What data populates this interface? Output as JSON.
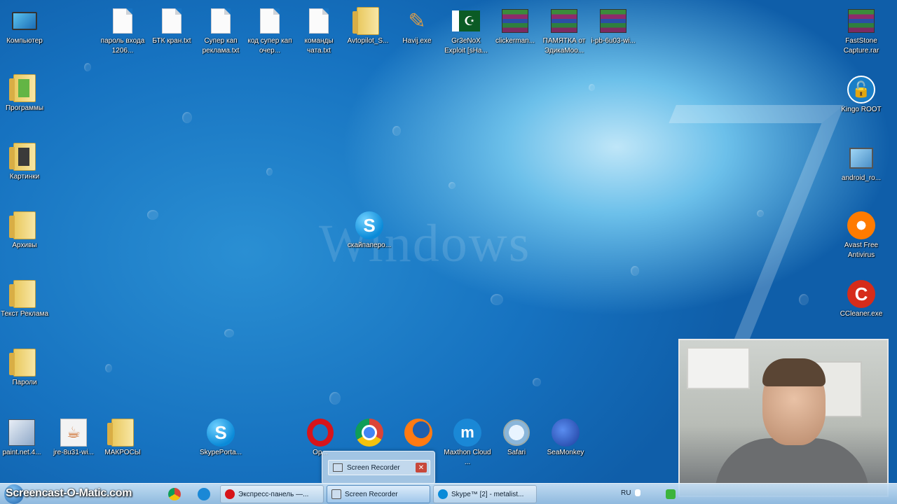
{
  "desktop": {
    "left_column": [
      {
        "label": "Компьютер",
        "icon": "computer-icon"
      },
      {
        "label": "Программы",
        "icon": "folder-icon"
      },
      {
        "label": "Картинки",
        "icon": "folder-icon"
      },
      {
        "label": "Архивы",
        "icon": "folder-icon"
      },
      {
        "label": "Текст Реклама",
        "icon": "folder-icon"
      },
      {
        "label": "Пароли",
        "icon": "folder-icon"
      }
    ],
    "top_row": [
      {
        "label": "пароль входа 1206...",
        "icon": "text-file-icon"
      },
      {
        "label": "БТК кран.txt",
        "icon": "text-file-icon"
      },
      {
        "label": "Супер кап реклама.txt",
        "icon": "text-file-icon"
      },
      {
        "label": "код супер кап очер...",
        "icon": "text-file-icon"
      },
      {
        "label": "команды чата.txt",
        "icon": "text-file-icon"
      },
      {
        "label": "Avtopilot_S...",
        "icon": "folder-icon"
      },
      {
        "label": "Havij.exe",
        "icon": "havij-icon"
      },
      {
        "label": "Gr3eNoX Exploit [sHa...",
        "icon": "pakistan-flag-icon"
      },
      {
        "label": "clickerman...",
        "icon": "winrar-icon"
      },
      {
        "label": "ПАМЯТКА от ЭдикаMoo...",
        "icon": "winrar-icon"
      },
      {
        "label": "i-pb-6u03-wi...",
        "icon": "winrar-icon"
      }
    ],
    "right_column": [
      {
        "label": "FastStone Capture.rar",
        "icon": "winrar-icon"
      },
      {
        "label": "Kingo ROOT",
        "icon": "kingo-root-icon"
      },
      {
        "label": "android_ro...",
        "icon": "computer-setup-icon"
      },
      {
        "label": "Avast Free Antivirus",
        "icon": "avast-icon"
      },
      {
        "label": "CCleaner.exe",
        "icon": "ccleaner-icon"
      }
    ],
    "center_icon": {
      "label": "скайпаперо...",
      "icon": "skype-icon"
    },
    "bottom_row": [
      {
        "label": "paint.net.4...",
        "icon": "paint-net-icon"
      },
      {
        "label": "jre-8u31-wi...",
        "icon": "java-icon"
      },
      {
        "label": "МАКРОСЫ",
        "icon": "folder-icon"
      },
      {
        "label": "SkypePorta...",
        "icon": "skype-icon"
      },
      {
        "label": "Op...",
        "icon": "opera-icon"
      },
      {
        "label": "",
        "icon": "chrome-icon"
      },
      {
        "label": "",
        "icon": "firefox-icon"
      },
      {
        "label": "Maxthon Cloud ...",
        "icon": "maxthon-icon"
      },
      {
        "label": "Safari",
        "icon": "safari-icon"
      },
      {
        "label": "SeaMonkey",
        "icon": "seamonkey-icon"
      }
    ],
    "wallpaper_text": "Windows"
  },
  "popup": {
    "title": "Screen Recorder"
  },
  "taskbar": {
    "brand": "Screencast-O-Matic.com",
    "tasks": [
      {
        "label": "Экспресс-панель —...",
        "icon": "opera-icon",
        "active": false
      },
      {
        "label": "Screen Recorder",
        "icon": "screen-recorder-icon",
        "active": true
      },
      {
        "label": "Skype™ [2] - metalist...",
        "icon": "skype-icon",
        "active": false
      }
    ],
    "language": "RU"
  },
  "colors": {
    "desktop_blue": "#1672c0",
    "taskbar": "#b8d5ee",
    "opera_red": "#d7141a",
    "skype_blue": "#0a8ad8"
  }
}
